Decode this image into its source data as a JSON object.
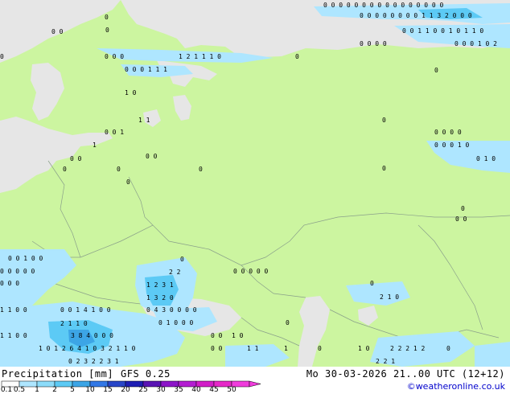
{
  "map": {
    "colors": {
      "land": "#ccf5a0",
      "sea": "#e6e6e6",
      "border": "#8aa08a",
      "precip_light": "#aee6ff",
      "precip_mid": "#5ccaf5",
      "precip_heavy": "#3278e6"
    },
    "labels": [
      {
        "id": "0",
        "text": "0 0"
      },
      {
        "id": "1",
        "text": "0"
      },
      {
        "id": "2",
        "text": "0"
      },
      {
        "id": "3",
        "text": "0 0 0 0 0 0 0 0 0 0 0 0 0 0 0 0"
      },
      {
        "id": "4",
        "text": "0 0 0 0 0 0 0 0 1 1 3 2 0 0 0"
      },
      {
        "id": "5",
        "text": "0 0 1 1 0 0 1 0 1 1 0"
      },
      {
        "id": "6",
        "text": "0 0 0 0"
      },
      {
        "id": "7",
        "text": "0 0 0 1 0 2"
      },
      {
        "id": "8",
        "text": "0 0 0"
      },
      {
        "id": "9",
        "text": "1 2 1 1 1 0"
      },
      {
        "id": "10",
        "text": "0"
      },
      {
        "id": "11",
        "text": "0"
      },
      {
        "id": "12",
        "text": "0 0 0 1 1 1"
      },
      {
        "id": "13",
        "text": "1 0"
      },
      {
        "id": "14",
        "text": "0"
      },
      {
        "id": "15",
        "text": "1 1"
      },
      {
        "id": "16",
        "text": "0"
      },
      {
        "id": "17",
        "text": "0 0 1"
      },
      {
        "id": "18",
        "text": "0 0 0 0"
      },
      {
        "id": "19",
        "text": "0 0 0 1 0"
      },
      {
        "id": "20",
        "text": "0 1 0"
      },
      {
        "id": "21",
        "text": "1"
      },
      {
        "id": "22",
        "text": "0 0"
      },
      {
        "id": "23",
        "text": "0 0"
      },
      {
        "id": "24",
        "text": "0"
      },
      {
        "id": "25",
        "text": "0"
      },
      {
        "id": "26",
        "text": "0"
      },
      {
        "id": "27",
        "text": "0"
      },
      {
        "id": "28",
        "text": "0"
      },
      {
        "id": "29",
        "text": "0"
      },
      {
        "id": "30",
        "text": "0 0"
      },
      {
        "id": "31",
        "text": "0 0 1 0 0"
      },
      {
        "id": "32",
        "text": "0"
      },
      {
        "id": "33",
        "text": "0 0 0 0 0"
      },
      {
        "id": "34",
        "text": "2 2"
      },
      {
        "id": "35",
        "text": "0 0 0 0 0"
      },
      {
        "id": "36",
        "text": "0 0 0"
      },
      {
        "id": "37",
        "text": "1 2 3 1"
      },
      {
        "id": "38",
        "text": "0"
      },
      {
        "id": "39",
        "text": "2 1 0"
      },
      {
        "id": "40",
        "text": "1 3 2 0"
      },
      {
        "id": "41",
        "text": "0 0 1 4 1 0 0"
      },
      {
        "id": "42",
        "text": "0 4 3 0 0 0 0"
      },
      {
        "id": "43",
        "text": "1 1 0 0"
      },
      {
        "id": "44",
        "text": "2 1 1 0"
      },
      {
        "id": "45",
        "text": "0 1 0 0 0"
      },
      {
        "id": "46",
        "text": "0"
      },
      {
        "id": "47",
        "text": "1 1 0 0"
      },
      {
        "id": "48",
        "text": "3 8 4 0 0 0"
      },
      {
        "id": "49",
        "text": "0 0"
      },
      {
        "id": "50",
        "text": "1 0"
      },
      {
        "id": "51",
        "text": "1 0 1 2 6 4 1 0 3 2 1 1 0"
      },
      {
        "id": "52",
        "text": "0 0"
      },
      {
        "id": "53",
        "text": "1 1"
      },
      {
        "id": "54",
        "text": "1"
      },
      {
        "id": "55",
        "text": "0"
      },
      {
        "id": "56",
        "text": "1 0"
      },
      {
        "id": "57",
        "text": "2 2 2 1 2"
      },
      {
        "id": "58",
        "text": "0"
      },
      {
        "id": "59",
        "text": "0 2 3 2 2 3 1"
      },
      {
        "id": "60",
        "text": "2 2 1"
      }
    ]
  },
  "footer": {
    "title": "Precipitation [mm]",
    "model": "GFS 0.25",
    "valid": "Mo 30-03-2026 21..00 UTC (12+12)",
    "credit": "©weatheronline.co.uk"
  },
  "legend": {
    "ticks": [
      "0.1",
      "0.5",
      "1",
      "2",
      "5",
      "10",
      "15",
      "20",
      "25",
      "30",
      "35",
      "40",
      "45",
      "50"
    ],
    "colors": [
      "#fdfdfd",
      "#aee6ff",
      "#8cdcfa",
      "#5ccaf5",
      "#3ca5e6",
      "#3278e6",
      "#2846c8",
      "#1e1eb4",
      "#5a14b4",
      "#8c14c8",
      "#b41ed2",
      "#d21ec8",
      "#e628c8",
      "#f03cdc"
    ]
  }
}
